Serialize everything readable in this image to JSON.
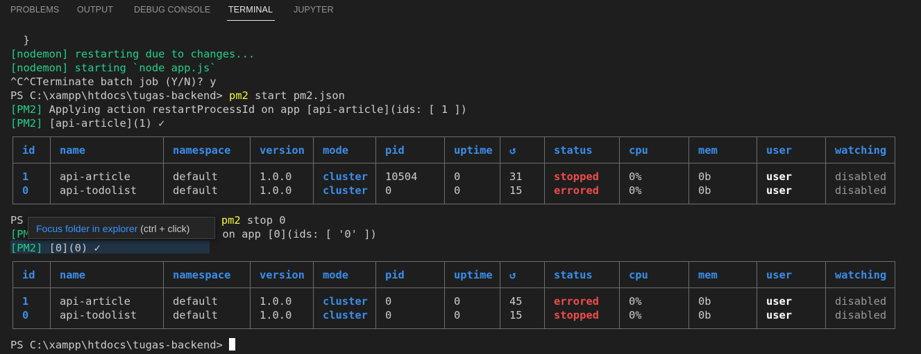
{
  "tabs": [
    {
      "label": "PROBLEMS"
    },
    {
      "label": "OUTPUT"
    },
    {
      "label": "DEBUG CONSOLE"
    },
    {
      "label": "TERMINAL"
    },
    {
      "label": "JUPYTER"
    }
  ],
  "terminal": {
    "line_brace": "  }",
    "nodemon_restart": "[nodemon] restarting due to changes...",
    "nodemon_start": "[nodemon] starting `node app.js`",
    "terminate": "^C^CTerminate batch job (Y/N)? y",
    "prompt": "PS C:\\xampp\\htdocs\\tugas-backend> ",
    "cmd1_name": "pm2",
    "cmd1_args": " start pm2.json",
    "pm2_tag": "[PM2]",
    "applying1": " Applying action restartProcessId on app [api-article](ids: [ 1 ])",
    "done1": " [api-article](1) ✓",
    "prompt2_ps": "PS ",
    "cmd2_name": "pm2",
    "cmd2_args": " stop 0",
    "pm2_tag_partial": "[PM",
    "applying2_tail": "d on app [0](ids: [ '0' ])",
    "done2": " [0](0) ✓",
    "final_prompt": "PS C:\\xampp\\htdocs\\tugas-backend> "
  },
  "tooltip": {
    "link": "Focus folder in explorer",
    "hint": " (ctrl + click)"
  },
  "table_headers": [
    "id",
    "name",
    "namespace",
    "version",
    "mode",
    "pid",
    "uptime",
    "↺",
    "status",
    "cpu",
    "mem",
    "user",
    "watching"
  ],
  "table1": [
    {
      "id": "1",
      "name": "api-article",
      "namespace": "default",
      "version": "1.0.0",
      "mode": "cluster",
      "pid": "10504",
      "uptime": "0",
      "restarts": "31",
      "status": "stopped",
      "cpu": "0%",
      "mem": "0b",
      "user": "user",
      "watching": "disabled"
    },
    {
      "id": "0",
      "name": "api-todolist",
      "namespace": "default",
      "version": "1.0.0",
      "mode": "cluster",
      "pid": "0",
      "uptime": "0",
      "restarts": "15",
      "status": "errored",
      "cpu": "0%",
      "mem": "0b",
      "user": "user",
      "watching": "disabled"
    }
  ],
  "table2": [
    {
      "id": "1",
      "name": "api-article",
      "namespace": "default",
      "version": "1.0.0",
      "mode": "cluster",
      "pid": "0",
      "uptime": "0",
      "restarts": "45",
      "status": "errored",
      "cpu": "0%",
      "mem": "0b",
      "user": "user",
      "watching": "disabled"
    },
    {
      "id": "0",
      "name": "api-todolist",
      "namespace": "default",
      "version": "1.0.0",
      "mode": "cluster",
      "pid": "0",
      "uptime": "0",
      "restarts": "15",
      "status": "stopped",
      "cpu": "0%",
      "mem": "0b",
      "user": "user",
      "watching": "disabled"
    }
  ],
  "colors": {
    "background": "#1e1e1e",
    "green": "#23d18b",
    "yellow": "#f5f543",
    "blue": "#3b8eea",
    "red": "#f14c4c"
  }
}
